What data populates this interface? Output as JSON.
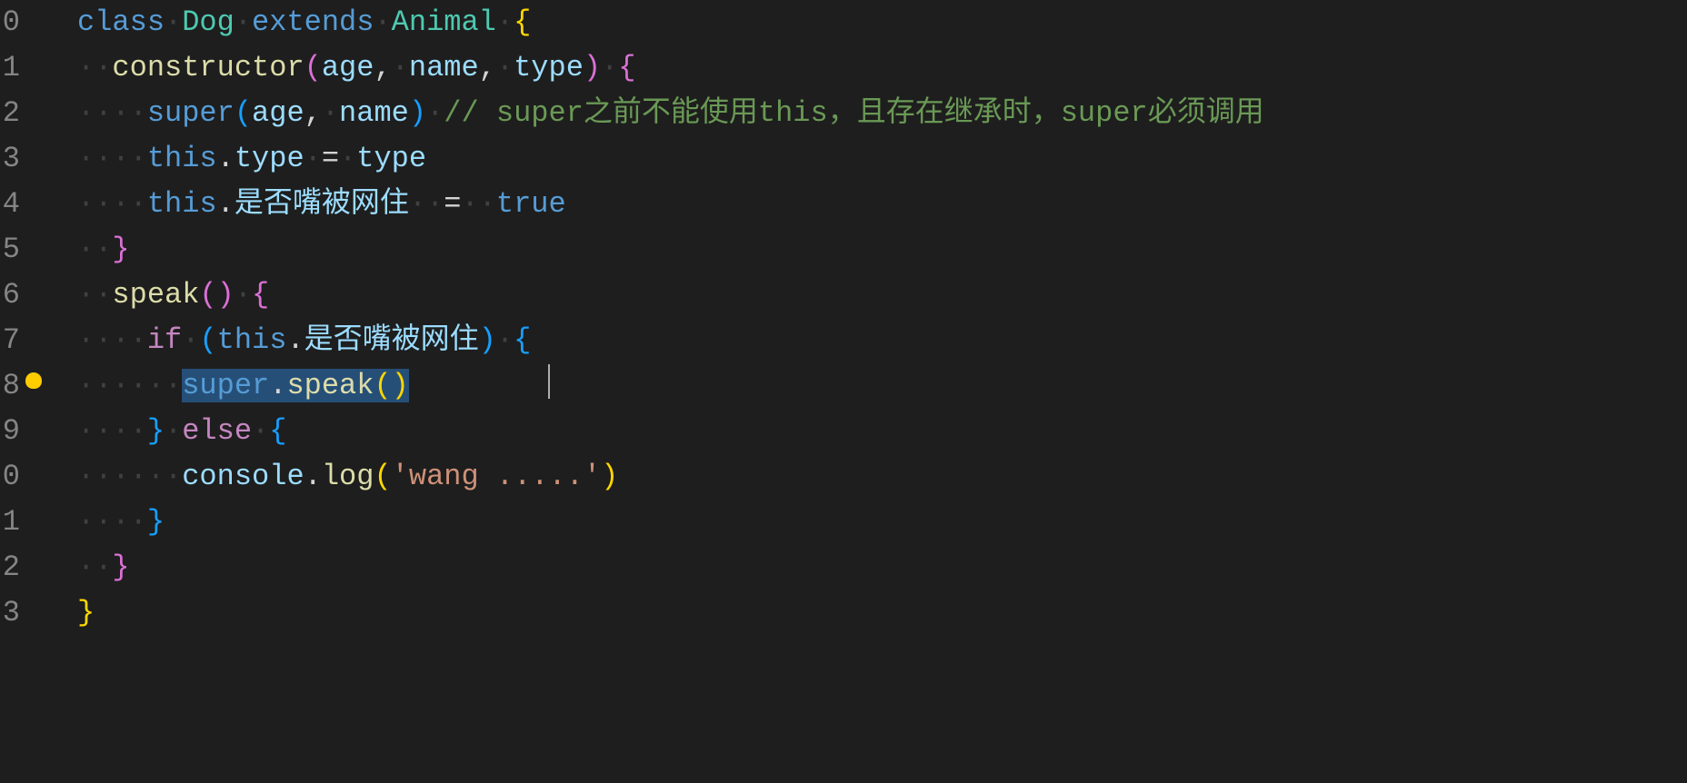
{
  "lineNumbers": [
    "0",
    "1",
    "2",
    "3",
    "4",
    "5",
    "6",
    "7",
    "8",
    "9",
    "0",
    "1",
    "2",
    "3"
  ],
  "lightbulbLine": 8,
  "code": {
    "l0": {
      "kw_class": "class",
      "cls1": "Dog",
      "kw_ext": "extends",
      "cls2": "Animal",
      "brace": "{"
    },
    "l1": {
      "fn": "constructor",
      "p1": "age",
      "p2": "name",
      "p3": "type",
      "brace": "{"
    },
    "l2": {
      "super": "super",
      "p1": "age",
      "p2": "name",
      "comment": "// super之前不能使用this，且存在继承时，super必须调用"
    },
    "l3": {
      "this": "this",
      "prop": "type",
      "eq": "=",
      "val": "type"
    },
    "l4": {
      "this": "this",
      "prop": "是否嘴被网住",
      "eq": "=",
      "val": "true"
    },
    "l5": {
      "brace": "}"
    },
    "l6": {
      "fn": "speak",
      "brace": "{"
    },
    "l7": {
      "if": "if",
      "this": "this",
      "prop": "是否嘴被网住",
      "brace": "{"
    },
    "l8": {
      "super": "super",
      "fn": "speak"
    },
    "l9": {
      "brace1": "}",
      "else": "else",
      "brace2": "{"
    },
    "l10": {
      "obj": "console",
      "fn": "log",
      "str": "'wang .....'"
    },
    "l11": {
      "brace": "}"
    },
    "l12": {
      "brace": "}"
    },
    "l13": {
      "brace": "}"
    }
  },
  "ws": "·"
}
